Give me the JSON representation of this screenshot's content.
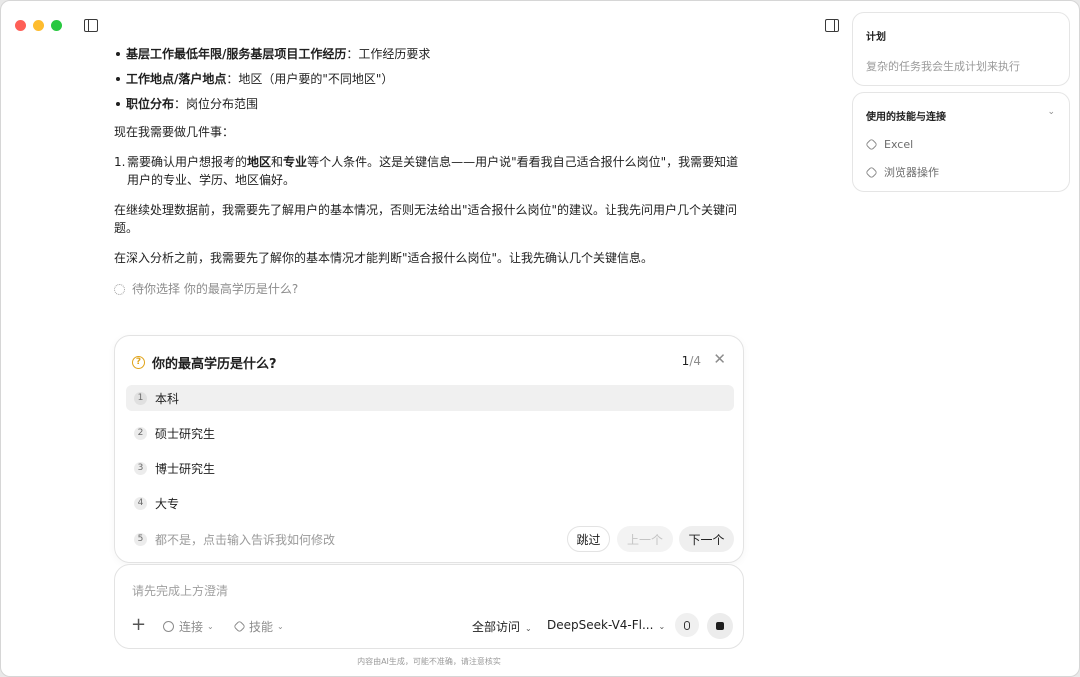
{
  "chat": {
    "bullets": [
      {
        "bold": "基层工作最低年限/服务基层项目工作经历",
        "rest": "：工作经历要求"
      },
      {
        "bold": "工作地点/落户地点",
        "rest": "：地区（用户要的\"不同地区\"）"
      },
      {
        "bold": "职位分布",
        "rest": "：岗位分布范围"
      }
    ],
    "intro": "现在我需要做几件事：",
    "step_num": "1.",
    "step_parts": [
      "需要确认用户想报考的",
      "地区",
      "和",
      "专业",
      "等个人条件。这是关键信息——用户说\"看看我自己适合报什么岗位\"，我需要知道用户的专业、学历、地区偏好。"
    ],
    "para1": "在继续处理数据前，我需要先了解用户的基本情况，否则无法给出\"适合报什么岗位\"的建议。让我先问用户几个关键问题。",
    "para2": "在深入分析之前，我需要先了解你的基本情况才能判断\"适合报什么岗位\"。让我先确认几个关键信息。",
    "waiting": "待你选择 你的最高学历是什么?"
  },
  "question": {
    "icon": "?",
    "title": "你的最高学历是什么?",
    "current": "1",
    "total": "/4",
    "close": "✕",
    "options": [
      {
        "num": "1",
        "label": "本科"
      },
      {
        "num": "2",
        "label": "硕士研究生"
      },
      {
        "num": "3",
        "label": "博士研究生"
      },
      {
        "num": "4",
        "label": "大专"
      }
    ],
    "other_num": "5",
    "other_label": "都不是，点击输入告诉我如何修改",
    "skip": "跳过",
    "prev": "上一个",
    "next": "下一个"
  },
  "composer": {
    "placeholder": "请先完成上方澄清",
    "plus": "+",
    "connect": "连接",
    "skills": "技能",
    "access": "全部访问",
    "model": "DeepSeek-V4-Fl...",
    "chevron": "⌄"
  },
  "disclaimer": "内容由AI生成，可能不准确，请注意核实",
  "plan": {
    "title": "计划",
    "desc": "复杂的任务我会生成计划来执行"
  },
  "skills_panel": {
    "title": "使用的技能与连接",
    "items": [
      "Excel",
      "浏览器操作"
    ],
    "chevron": "⌄"
  }
}
